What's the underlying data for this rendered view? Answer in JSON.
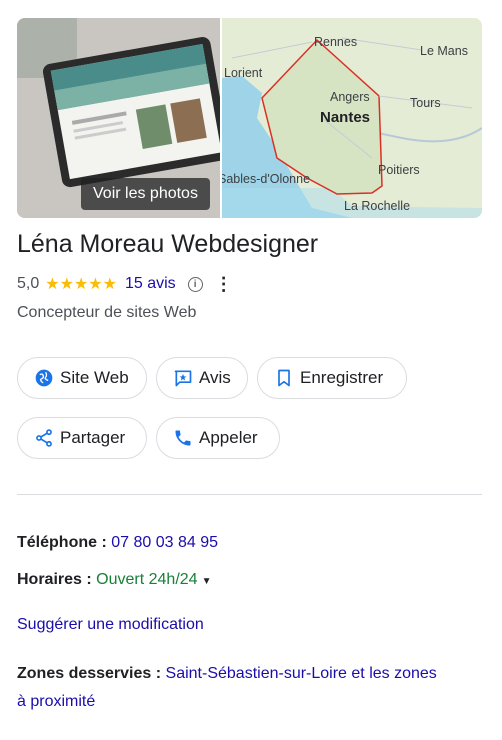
{
  "media": {
    "photos_button": "Voir les photos",
    "map_labels": [
      "Rennes",
      "Le Mans",
      "Lorient",
      "Angers",
      "Nantes",
      "Tours",
      "Poitiers",
      "Sables-d'Olonne",
      "La Rochelle"
    ]
  },
  "business": {
    "name": "Léna Moreau Webdesigner",
    "rating": "5,0",
    "stars": "★★★★★",
    "reviews": "15 avis",
    "info_icon": "i",
    "more_icon": "⋮",
    "category": "Concepteur de sites Web"
  },
  "actions": {
    "website": "Site Web",
    "reviews": "Avis",
    "save": "Enregistrer",
    "share": "Partager",
    "call": "Appeler"
  },
  "details": {
    "phone_label": "Téléphone :",
    "phone_value": "07 80 03 84 95",
    "hours_label": "Horaires :",
    "hours_value": "Ouvert 24h/24",
    "suggest_edit": "Suggérer une modification",
    "zones_label": "Zones desservies :",
    "zones_value_line1": "Saint-Sébastien-sur-Loire et les zones",
    "zones_value_line2": "à proximité"
  },
  "colors": {
    "link": "#1a0dab",
    "open": "#188038",
    "star": "#fbbc04",
    "icon_blue": "#1a73e8"
  },
  "icons": [
    "globe-icon",
    "star-review-icon",
    "bookmark-icon",
    "share-icon",
    "phone-icon",
    "info-icon",
    "more-vert-icon",
    "dropdown-icon"
  ]
}
